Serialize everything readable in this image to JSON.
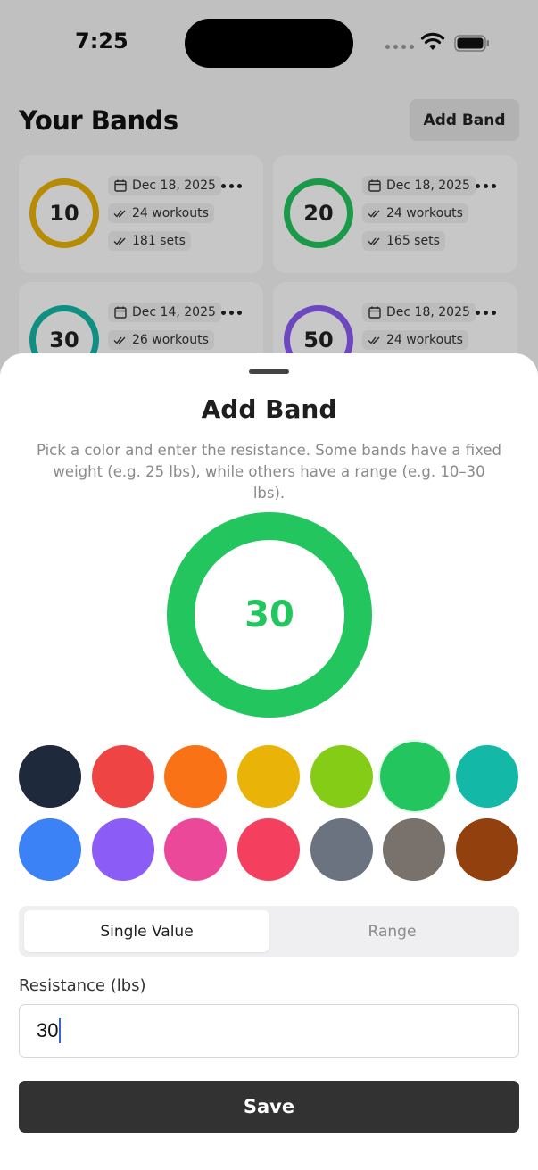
{
  "status_bar": {
    "time": "7:25"
  },
  "background": {
    "title": "Your Bands",
    "add_button_label": "Add Band",
    "bands": [
      {
        "value": "10",
        "ring_color": "#eab308",
        "date": "Dec 18, 2025",
        "workouts": "24 workouts",
        "sets": "181 sets"
      },
      {
        "value": "20",
        "ring_color": "#22c55e",
        "date": "Dec 18, 2025",
        "workouts": "24 workouts",
        "sets": "165 sets"
      },
      {
        "value": "30",
        "ring_color": "#14b8a6",
        "date": "Dec 14, 2025",
        "workouts": "26 workouts"
      },
      {
        "value": "50",
        "ring_color": "#8b5cf6",
        "date": "Dec 18, 2025",
        "workouts": "24 workouts"
      }
    ]
  },
  "sheet": {
    "title": "Add Band",
    "description": "Pick a color and enter the resistance. Some bands have a fixed weight (e.g. 25 lbs), while others have a range (e.g. 10–30 lbs).",
    "preview": {
      "value": "30",
      "color": "#22c55e"
    },
    "colors": [
      "#1e293b",
      "#ef4444",
      "#f97316",
      "#eab308",
      "#84cc16",
      "#22c55e",
      "#14b8a6",
      "#3b82f6",
      "#8b5cf6",
      "#ec4899",
      "#f43f5e",
      "#6b7280",
      "#78716c",
      "#92400e"
    ],
    "selected_color": "#22c55e",
    "mode_tabs": {
      "single": "Single Value",
      "range": "Range",
      "active": "single"
    },
    "resistance": {
      "label": "Resistance (lbs)",
      "value": "30"
    },
    "save_label": "Save"
  }
}
